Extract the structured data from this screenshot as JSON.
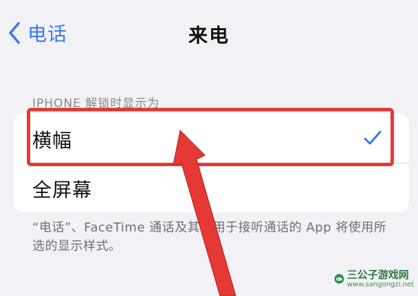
{
  "nav": {
    "back_label": "电话",
    "title": "来电"
  },
  "section": {
    "header": "IPHONE 解锁时显示为"
  },
  "options": [
    {
      "label": "横幅",
      "selected": true
    },
    {
      "label": "全屏幕",
      "selected": false
    }
  ],
  "footer": {
    "note": "“电话”、FaceTime 通话及其他用于接听通话的 App 将使用所选的显示样式。"
  },
  "watermark": {
    "title": "三公子游戏网",
    "url": "www.sangongzi.net"
  },
  "colors": {
    "accent": "#3478f6",
    "annotation_red": "#e53935",
    "background": "#f2f2f6"
  },
  "icons": {
    "back": "chevron-left-icon",
    "check": "checkmark-icon"
  }
}
